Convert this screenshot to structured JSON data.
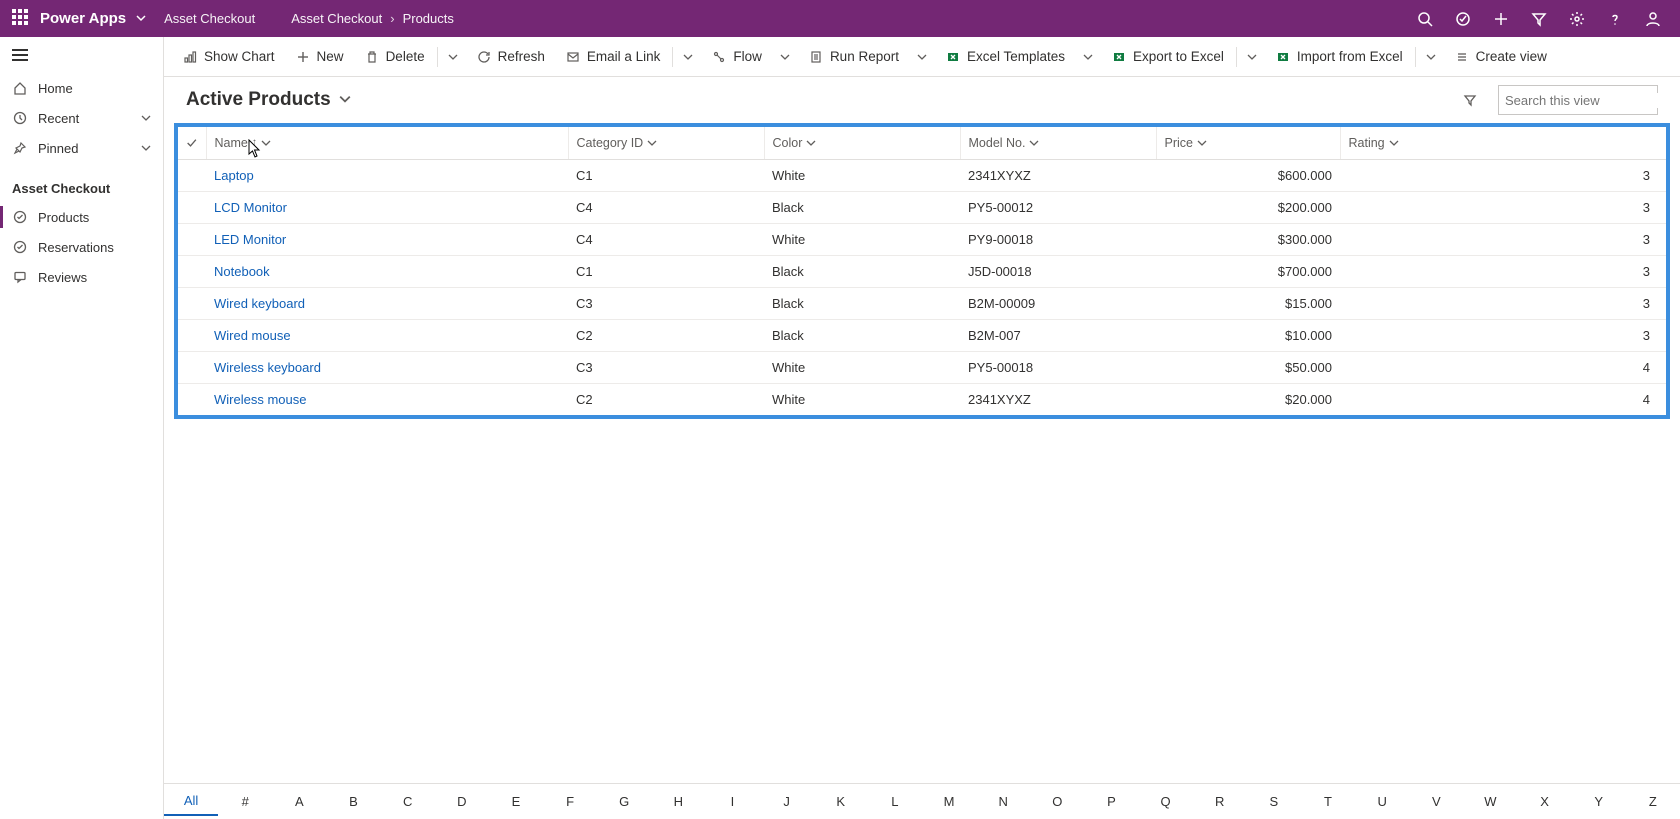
{
  "topbar": {
    "brand": "Power Apps",
    "crumb1": "Asset Checkout",
    "crumb2": "Asset Checkout",
    "crumb3": "Products"
  },
  "sidebar": {
    "home": "Home",
    "recent": "Recent",
    "pinned": "Pinned",
    "section": "Asset Checkout",
    "products": "Products",
    "reservations": "Reservations",
    "reviews": "Reviews"
  },
  "cmd": {
    "show_chart": "Show Chart",
    "new": "New",
    "delete": "Delete",
    "refresh": "Refresh",
    "email_link": "Email a Link",
    "flow": "Flow",
    "run_report": "Run Report",
    "excel_templates": "Excel Templates",
    "export_excel": "Export to Excel",
    "import_excel": "Import from Excel",
    "create_view": "Create view"
  },
  "view": {
    "title": "Active Products",
    "search_placeholder": "Search this view"
  },
  "columns": {
    "name": "Name",
    "category": "Category ID",
    "color": "Color",
    "model": "Model No.",
    "price": "Price",
    "rating": "Rating"
  },
  "rows": [
    {
      "name": "Laptop",
      "category": "C1",
      "color": "White",
      "model": "2341XYXZ",
      "price": "$600.000",
      "rating": "3"
    },
    {
      "name": "LCD Monitor",
      "category": "C4",
      "color": "Black",
      "model": "PY5-00012",
      "price": "$200.000",
      "rating": "3"
    },
    {
      "name": "LED Monitor",
      "category": "C4",
      "color": "White",
      "model": "PY9-00018",
      "price": "$300.000",
      "rating": "3"
    },
    {
      "name": "Notebook",
      "category": "C1",
      "color": "Black",
      "model": "J5D-00018",
      "price": "$700.000",
      "rating": "3"
    },
    {
      "name": "Wired keyboard",
      "category": "C3",
      "color": "Black",
      "model": "B2M-00009",
      "price": "$15.000",
      "rating": "3"
    },
    {
      "name": "Wired mouse",
      "category": "C2",
      "color": "Black",
      "model": "B2M-007",
      "price": "$10.000",
      "rating": "3"
    },
    {
      "name": "Wireless keyboard",
      "category": "C3",
      "color": "White",
      "model": "PY5-00018",
      "price": "$50.000",
      "rating": "4"
    },
    {
      "name": "Wireless mouse",
      "category": "C2",
      "color": "White",
      "model": "2341XYXZ",
      "price": "$20.000",
      "rating": "4"
    }
  ],
  "alpha": [
    "All",
    "#",
    "A",
    "B",
    "C",
    "D",
    "E",
    "F",
    "G",
    "H",
    "I",
    "J",
    "K",
    "L",
    "M",
    "N",
    "O",
    "P",
    "Q",
    "R",
    "S",
    "T",
    "U",
    "V",
    "W",
    "X",
    "Y",
    "Z"
  ]
}
